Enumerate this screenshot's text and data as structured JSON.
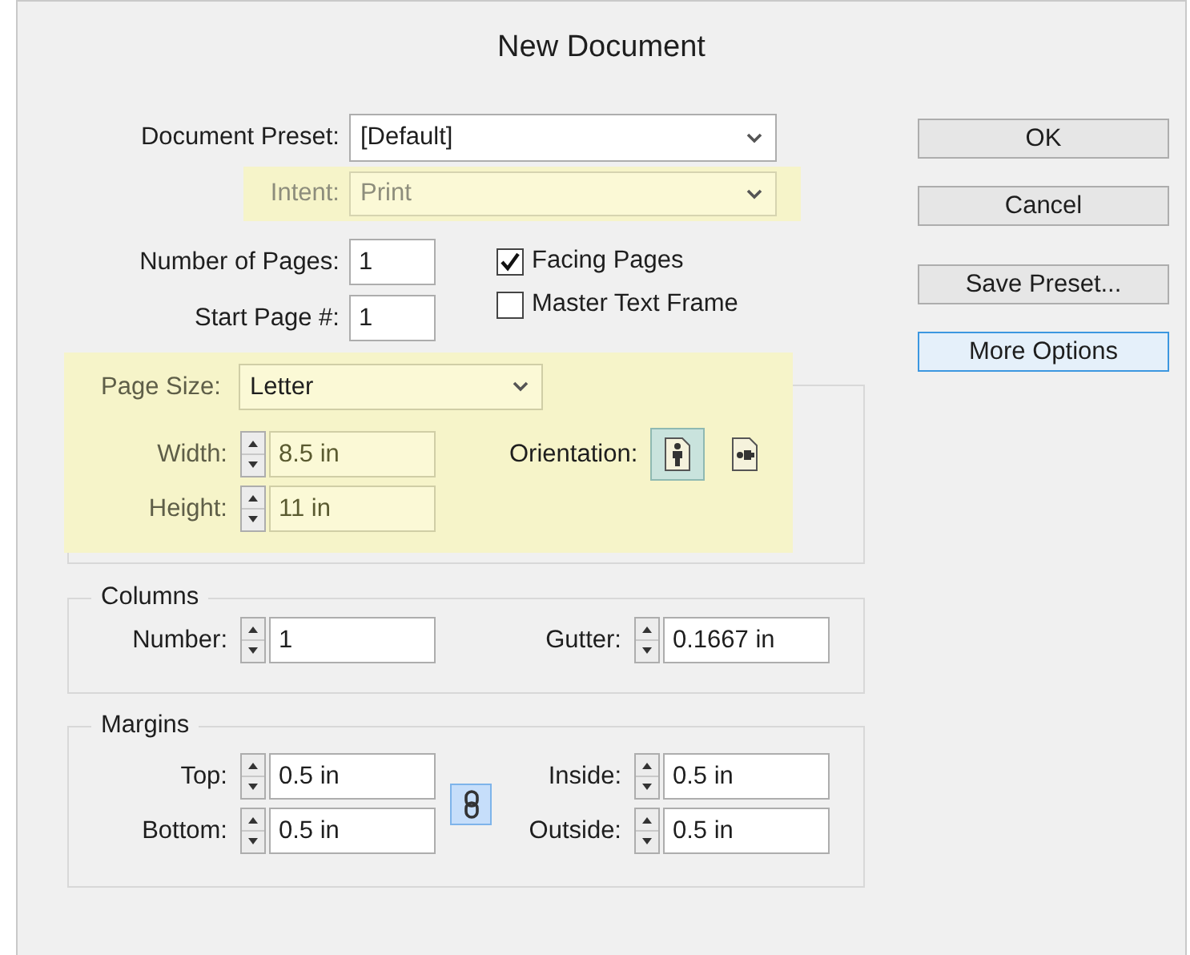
{
  "window": {
    "title": "New Document"
  },
  "document_preset": {
    "label": "Document Preset:",
    "value": "[Default]"
  },
  "intent": {
    "label": "Intent:",
    "value": "Print",
    "disabled": true,
    "highlighted": true
  },
  "number_of_pages": {
    "label": "Number of Pages:",
    "value": "1"
  },
  "start_page": {
    "label": "Start Page #:",
    "value": "1"
  },
  "checkboxes": [
    {
      "label": "Facing Pages",
      "checked": true
    },
    {
      "label": "Master Text Frame",
      "checked": false
    }
  ],
  "page_size": {
    "highlighted": true,
    "label": "Page Size:",
    "value": "Letter",
    "width": {
      "label": "Width:",
      "value": "8.5 in"
    },
    "height": {
      "label": "Height:",
      "value": "11 in"
    },
    "orientation": {
      "label": "Orientation:",
      "options": [
        {
          "kind": "portrait",
          "selected": true
        },
        {
          "kind": "landscape",
          "selected": false
        }
      ]
    }
  },
  "columns": {
    "title": "Columns",
    "number": {
      "label": "Number:",
      "value": "1"
    },
    "gutter": {
      "label": "Gutter:",
      "value": "0.1667 in"
    }
  },
  "margins": {
    "title": "Margins",
    "linked": true,
    "top": {
      "label": "Top:",
      "value": "0.5 in"
    },
    "bottom": {
      "label": "Bottom:",
      "value": "0.5 in"
    },
    "inside": {
      "label": "Inside:",
      "value": "0.5 in"
    },
    "outside": {
      "label": "Outside:",
      "value": "0.5 in"
    }
  },
  "buttons": [
    {
      "label": "OK",
      "focused": false
    },
    {
      "label": "Cancel",
      "focused": false
    },
    {
      "label": "Save Preset...",
      "focused": false
    },
    {
      "label": "More Options",
      "focused": true
    }
  ]
}
